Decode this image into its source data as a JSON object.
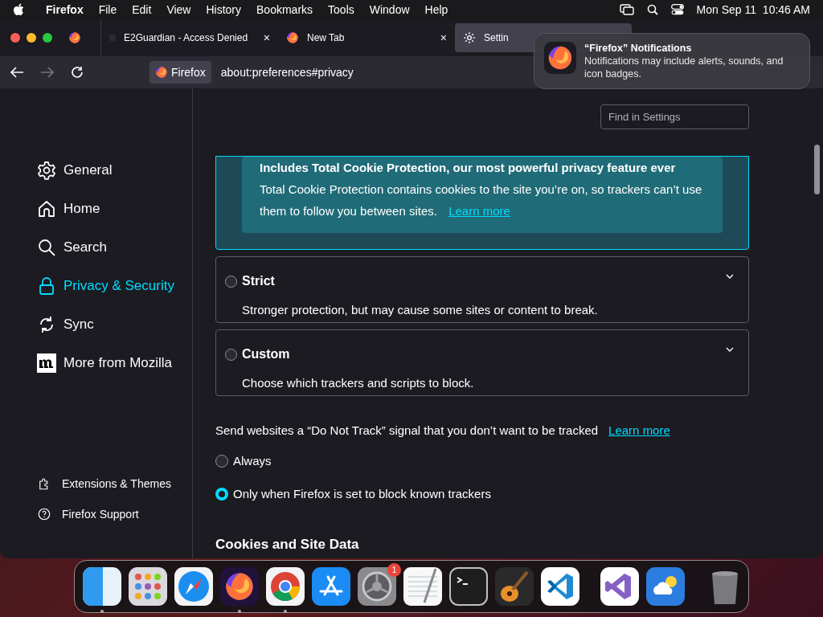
{
  "menu_bar": {
    "app": "Firefox",
    "items": [
      "File",
      "Edit",
      "View",
      "History",
      "Bookmarks",
      "Tools",
      "Window",
      "Help"
    ],
    "clock": "Mon Sep 11  10:46 AM"
  },
  "tabs": [
    {
      "kind": "firefox",
      "selected": false
    },
    {
      "kind": "blank",
      "title": "E2Guardian - Access Denied",
      "close": "×",
      "selected": false
    },
    {
      "kind": "firefox",
      "title": "New Tab",
      "close": "×",
      "selected": false
    },
    {
      "kind": "gear",
      "title": "Settin",
      "selected": true
    }
  ],
  "address_bar": {
    "identity": "Firefox",
    "url": "about:preferences#privacy"
  },
  "notification": {
    "title": "“Firefox” Notifications",
    "body": "Notifications may include alerts, sounds, and icon badges."
  },
  "sidebar": {
    "items": [
      {
        "kind": "gear",
        "label": "General",
        "selected": false
      },
      {
        "kind": "home",
        "label": "Home",
        "selected": false
      },
      {
        "kind": "search",
        "label": "Search",
        "selected": false
      },
      {
        "kind": "lock",
        "label": "Privacy & Security",
        "selected": true
      },
      {
        "kind": "sync",
        "label": "Sync",
        "selected": false
      },
      {
        "kind": "mozilla",
        "label": "More from Mozilla",
        "selected": false
      }
    ],
    "footer": [
      {
        "kind": "puzzle",
        "label": "Extensions & Themes"
      },
      {
        "kind": "help",
        "label": "Firefox Support"
      }
    ]
  },
  "search": {
    "placeholder": "Find in Settings"
  },
  "standard_box": {
    "heading": "Includes Total Cookie Protection, our most powerful privacy feature ever",
    "text": "Total Cookie Protection contains cookies to the site you’re on, so trackers can’t use them to follow you between sites.",
    "link": "Learn more"
  },
  "options": [
    {
      "label": "Strict",
      "description": "Stronger protection, but may cause some sites or content to break.",
      "selected": false
    },
    {
      "label": "Custom",
      "description": "Choose which trackers and scripts to block.",
      "selected": false
    }
  ],
  "do_not_track": {
    "text": "Send websites a “Do Not Track” signal that you don’t want to be tracked",
    "link": "Learn more",
    "choices": [
      {
        "label": "Always",
        "selected": false
      },
      {
        "label": "Only when Firefox is set to block known trackers",
        "selected": true
      }
    ]
  },
  "section_heading": "Cookies and Site Data",
  "dock": [
    {
      "kind": "finder",
      "running": true
    },
    {
      "kind": "launchpad",
      "running": false
    },
    {
      "kind": "safari",
      "running": false
    },
    {
      "kind": "firefox",
      "running": true
    },
    {
      "kind": "chrome",
      "running": true
    },
    {
      "kind": "appstore",
      "running": false
    },
    {
      "kind": "settings",
      "running": false,
      "badge": "1"
    },
    {
      "kind": "textedit",
      "running": false
    },
    {
      "kind": "terminal",
      "running": false
    },
    {
      "kind": "garageband",
      "running": false
    },
    {
      "kind": "vscode",
      "running": false
    },
    {
      "kind": "divider"
    },
    {
      "kind": "visualstudio",
      "running": false
    },
    {
      "kind": "weather",
      "running": false
    },
    {
      "kind": "divider"
    },
    {
      "kind": "trash",
      "running": false
    }
  ]
}
